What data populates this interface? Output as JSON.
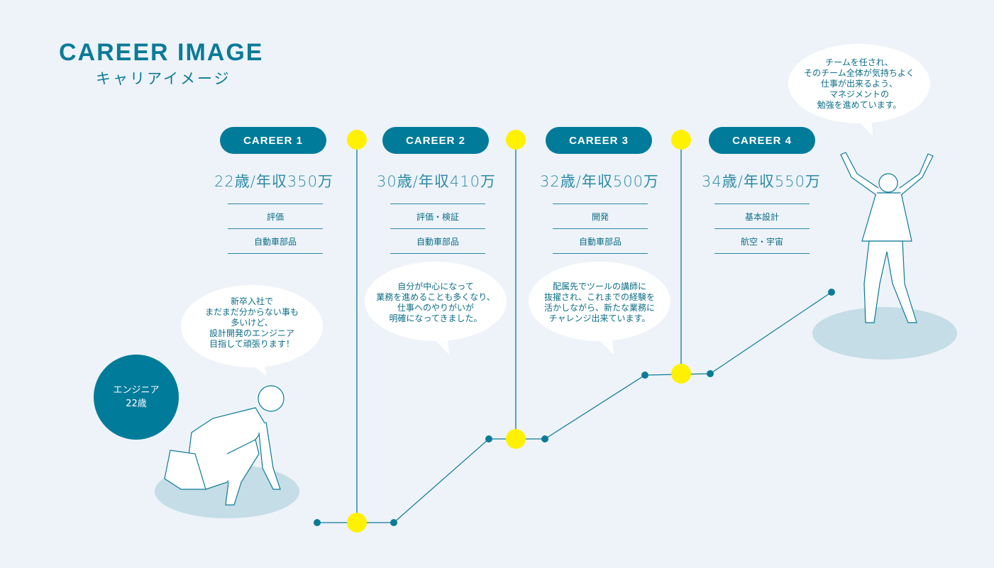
{
  "header": {
    "title": "CAREER IMAGE",
    "subtitle": "キャリアイメージ"
  },
  "start": {
    "label": "エンジニア",
    "age": "22歳"
  },
  "careers": [
    {
      "label": "CAREER 1",
      "salary": "22歳/年収350万",
      "role": "評価",
      "field": "自動車部品"
    },
    {
      "label": "CAREER 2",
      "salary": "30歳/年収410万",
      "role": "評価・検証",
      "field": "自動車部品"
    },
    {
      "label": "CAREER 3",
      "salary": "32歳/年収500万",
      "role": "開発",
      "field": "自動車部品"
    },
    {
      "label": "CAREER 4",
      "salary": "34歳/年収550万",
      "role": "基本設計",
      "field": "航空・宇宙"
    }
  ],
  "bubbles": [
    {
      "lines": [
        "新卒入社で",
        "まだまだ分からない事も",
        "多いけど、",
        "設計開発のエンジニア",
        "目指して頑張ります！"
      ]
    },
    {
      "lines": [
        "自分が中心になって",
        "業務を進めることも多くなり、",
        "仕事へのやりがいが",
        "明確になってきました。"
      ]
    },
    {
      "lines": [
        "配属先でツールの講師に",
        "抜擢され、これまでの経験を",
        "活かしながら、新たな業務に",
        "チャレンジ出来ています。"
      ]
    },
    {
      "lines": [
        "チームを任され、",
        "そのチーム全体が気持ちよく",
        "仕事が出来るよう、",
        "マネジメントの",
        "勉強を進めています。"
      ]
    }
  ],
  "colors": {
    "accent": "#007b9a",
    "milestone": "#fff100",
    "shadow": "#c4dde6",
    "background": "#eef3f9"
  }
}
